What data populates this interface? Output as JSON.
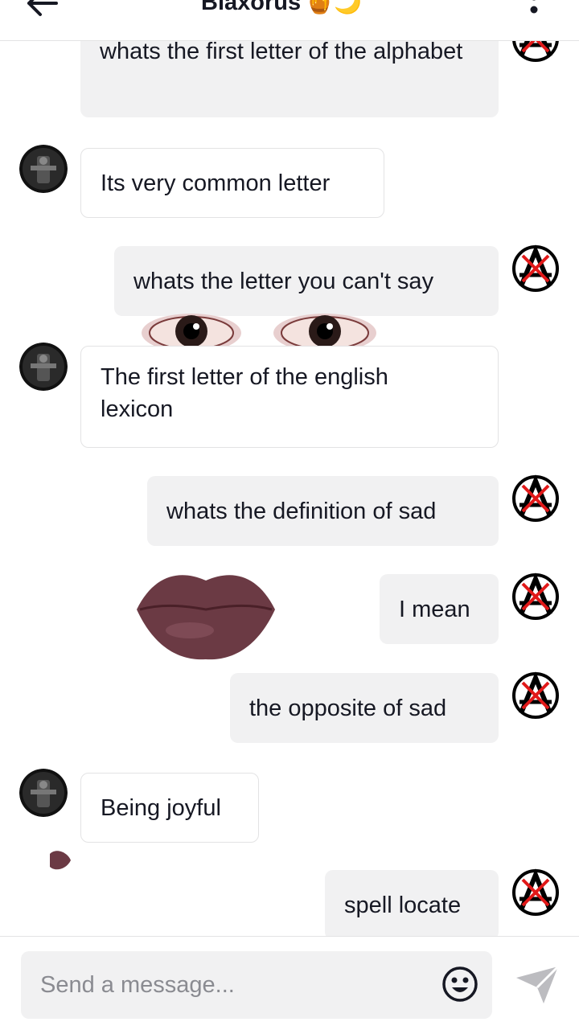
{
  "header": {
    "title": "Blaxorus",
    "title_emoji": "🍯🌙"
  },
  "messages": [
    {
      "side": "sent",
      "text": "whats the first letter of the alphabet"
    },
    {
      "side": "received",
      "text": "Its very common letter"
    },
    {
      "side": "sent",
      "text": "whats the letter you can't say"
    },
    {
      "side": "received",
      "text": "The first letter of the english lexicon"
    },
    {
      "side": "sent",
      "text": "whats the definition of sad"
    },
    {
      "side": "sent",
      "text": "I mean"
    },
    {
      "side": "sent",
      "text": "the opposite of sad"
    },
    {
      "side": "received",
      "text": "Being joyful"
    },
    {
      "side": "sent",
      "text": "spell locate"
    }
  ],
  "composer": {
    "placeholder": "Send a message..."
  },
  "icons": {
    "back": "arrow-left-icon",
    "more": "more-vertical-icon",
    "emoji": "emoji-face-icon",
    "send": "send-arrow-icon"
  },
  "colors": {
    "sent_bubble": "#f1f1f2",
    "received_border": "#e3e3e4",
    "text": "#161823",
    "placeholder": "#8a8b91",
    "avatar_mark": "#e11919"
  }
}
